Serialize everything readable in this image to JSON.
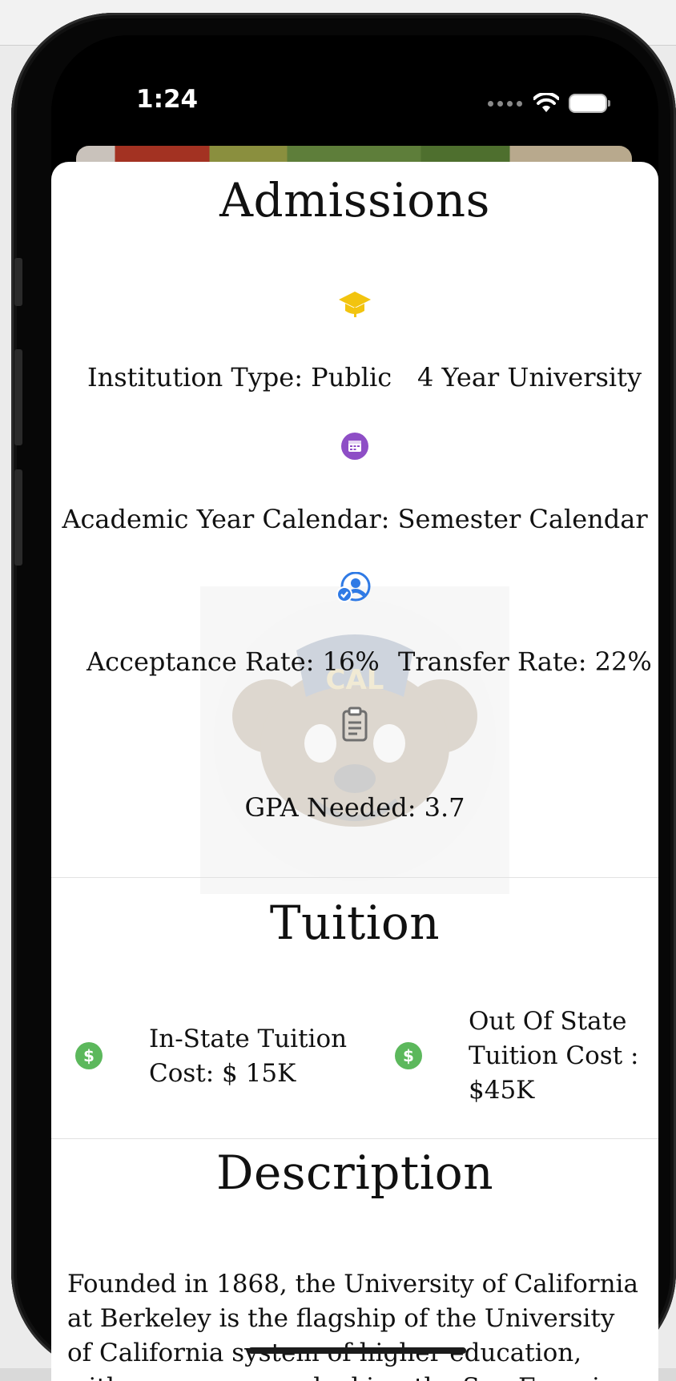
{
  "status_bar": {
    "time": "1:24",
    "wifi_icon": "wifi-icon",
    "battery_icon": "battery-icon"
  },
  "admissions": {
    "title": "Admissions",
    "institution_icon": "graduation-cap-icon",
    "institution_type": "Institution Type: Public",
    "institution_kind": "4 Year University",
    "calendar_icon": "calendar-icon",
    "academic_calendar": "Academic Year Calendar: Semester Calendar",
    "acceptance_icon": "user-check-icon",
    "acceptance_rate": "Acceptance Rate: 16%",
    "transfer_rate": "Transfer Rate: 22%",
    "gpa_icon": "clipboard-icon",
    "gpa_needed": "GPA Needed: 3.7",
    "mascot_lettering": "CAL"
  },
  "tuition": {
    "title": "Tuition",
    "in_state_icon": "dollar-icon",
    "in_state_line1": "In-State Tuition",
    "in_state_line2": "Cost: $ 15K",
    "out_state_icon": "dollar-icon",
    "out_state_line1": "Out Of State",
    "out_state_line2": "Tuition Cost :",
    "out_state_line3": "$45K"
  },
  "description": {
    "title": "Description",
    "text": "Founded in 1868, the University of California at Berkeley is the flagship of the University of California system of higher education, with a campus overlooking the San Francisco Bay."
  },
  "colors": {
    "cap": "#f2c40f",
    "calendar": "#8e4ec6",
    "acceptance": "#2f7ae5",
    "dollar": "#5cb85c"
  }
}
